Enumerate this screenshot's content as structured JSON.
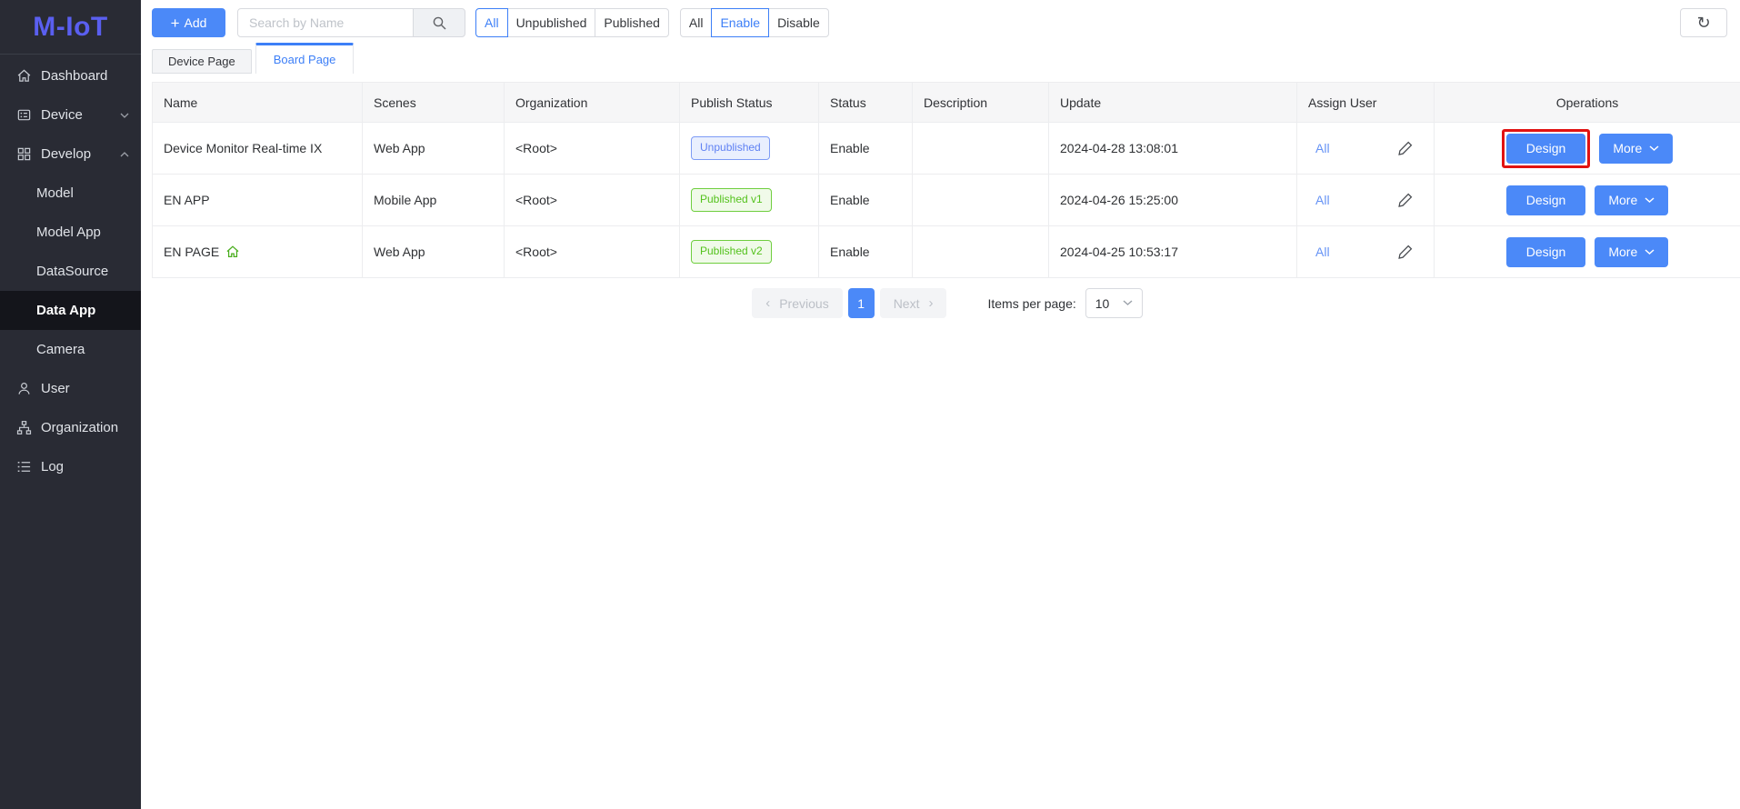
{
  "logo": "M-IoT",
  "sidebar": {
    "items": {
      "dashboard": "Dashboard",
      "device": "Device",
      "develop": "Develop",
      "model": "Model",
      "model_app": "Model App",
      "datasource": "DataSource",
      "data_app": "Data App",
      "camera": "Camera",
      "user": "User",
      "organization": "Organization",
      "log": "Log"
    }
  },
  "toolbar": {
    "add_label": "Add",
    "search_placeholder": "Search by Name",
    "publish_filter": {
      "all": "All",
      "unpublished": "Unpublished",
      "published": "Published"
    },
    "status_filter": {
      "all": "All",
      "enable": "Enable",
      "disable": "Disable"
    }
  },
  "tabs": {
    "device_page": "Device Page",
    "board_page": "Board Page"
  },
  "table": {
    "headers": [
      "Name",
      "Scenes",
      "Organization",
      "Publish Status",
      "Status",
      "Description",
      "Update",
      "Assign User",
      "Operations"
    ],
    "rows": [
      {
        "name": "Device Monitor Real-time IX",
        "scenes": "Web App",
        "organization": "<Root>",
        "publish_status": "Unpublished",
        "status": "Enable",
        "description": "",
        "update": "2024-04-28 13:08:01",
        "assign_user": "All"
      },
      {
        "name": "EN APP",
        "scenes": "Mobile App",
        "organization": "<Root>",
        "publish_status": "Published v1",
        "status": "Enable",
        "description": "",
        "update": "2024-04-26 15:25:00",
        "assign_user": "All"
      },
      {
        "name": "EN PAGE",
        "scenes": "Web App",
        "organization": "<Root>",
        "publish_status": "Published v2",
        "status": "Enable",
        "description": "",
        "update": "2024-04-25 10:53:17",
        "assign_user": "All"
      }
    ],
    "ops": {
      "design": "Design",
      "more": "More"
    }
  },
  "pagination": {
    "previous": "Previous",
    "page": "1",
    "next": "Next",
    "items_per_page_label": "Items per page:",
    "page_size": "10"
  },
  "icons": {
    "plus": "+",
    "chevron_left": "‹",
    "chevron_right": "›",
    "refresh": "↻"
  },
  "colors": {
    "primary_blue": "#4b89f8",
    "logo_purple": "#5a5ff0",
    "sidebar_bg": "#292b34",
    "badge_blue": "#5f81f3",
    "badge_green": "#54c21d",
    "highlight_red": "#e11212"
  }
}
